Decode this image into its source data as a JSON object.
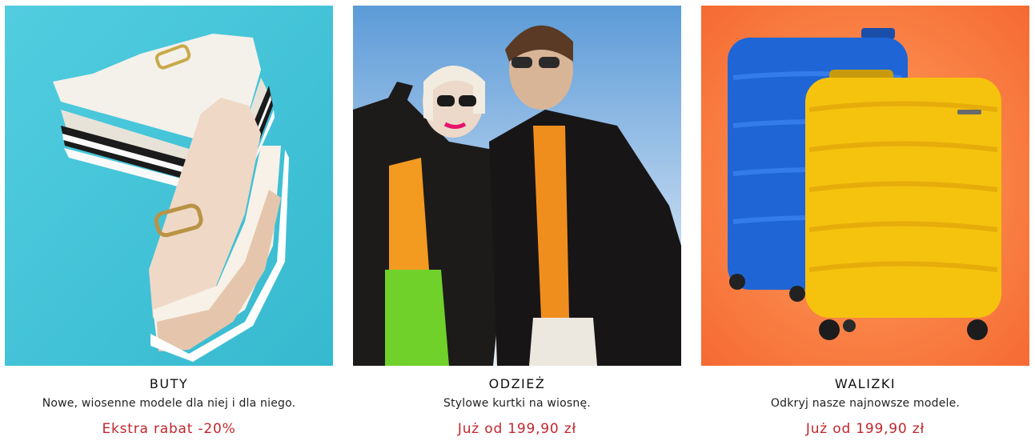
{
  "cards": [
    {
      "title": "BUTY",
      "description": "Nowe, wiosenne modele dla niej i dla niego.",
      "promo": "Ekstra rabat -20%",
      "image": "shoes-on-turquoise",
      "bg_color": "#46c3d7"
    },
    {
      "title": "ODZIEŻ",
      "description": "Stylowe kurtki na wiosnę.",
      "promo": "Już od 199,90 zł",
      "image": "couple-in-leather-jackets",
      "bg_color": "#8fb7df"
    },
    {
      "title": "WALIZKI",
      "description": "Odkryj nasze najnowsze modele.",
      "promo": "Już od 199,90 zł",
      "image": "suitcases-on-orange",
      "bg_color": "#f8793f"
    }
  ],
  "colors": {
    "promo": "#c1272d",
    "title": "#111111"
  }
}
